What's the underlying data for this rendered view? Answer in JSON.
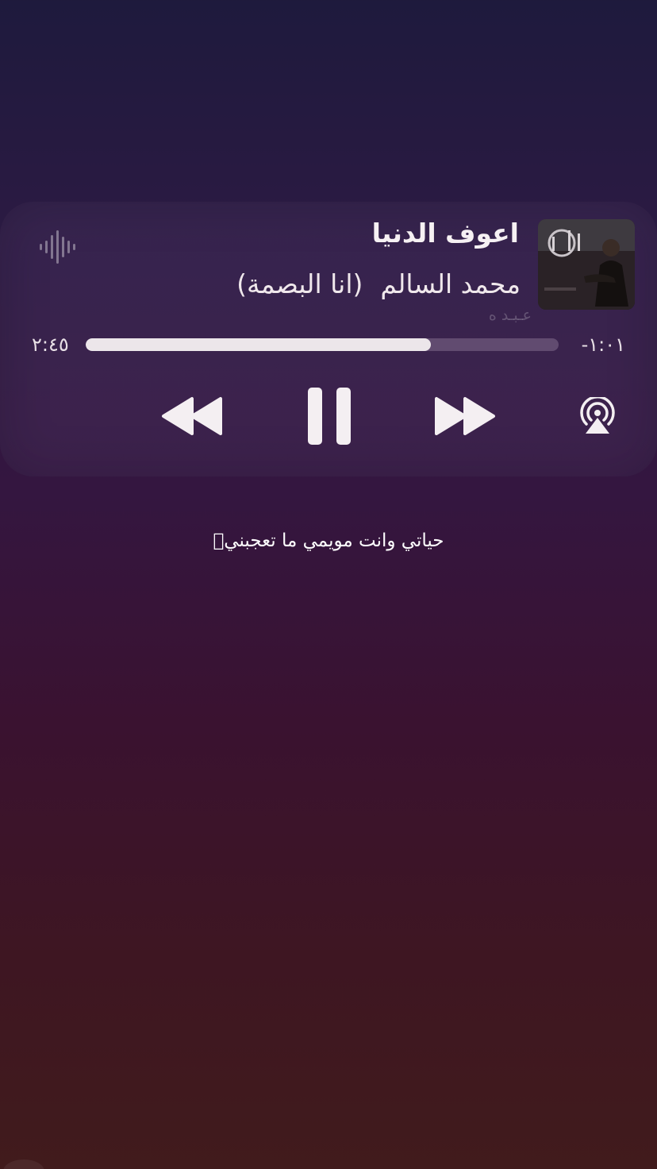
{
  "now_playing": {
    "title": "اعوف الدنيا",
    "artist": "محمد السالم",
    "album": "(انا البصمة)",
    "watermark": "عـبـد ه",
    "elapsed": "٢:٤٥",
    "remaining": "-١:٠١",
    "progress": 0.73,
    "state": "playing"
  },
  "controls": {
    "rewind_icon": "rewind-icon",
    "pause_icon": "pause-icon",
    "forward_icon": "fast-forward-icon",
    "airplay_icon": "airplay-audio-icon",
    "waveform_icon": "waveform-icon"
  },
  "lyric": {
    "text": "حياتي وانت مويمي ما تعجبنيؐ"
  },
  "colors": {
    "background_top": "#1e1a3d",
    "background_bottom": "#411b1c",
    "progress_fill": "#ece6ea",
    "icon": "#f4eff2"
  }
}
